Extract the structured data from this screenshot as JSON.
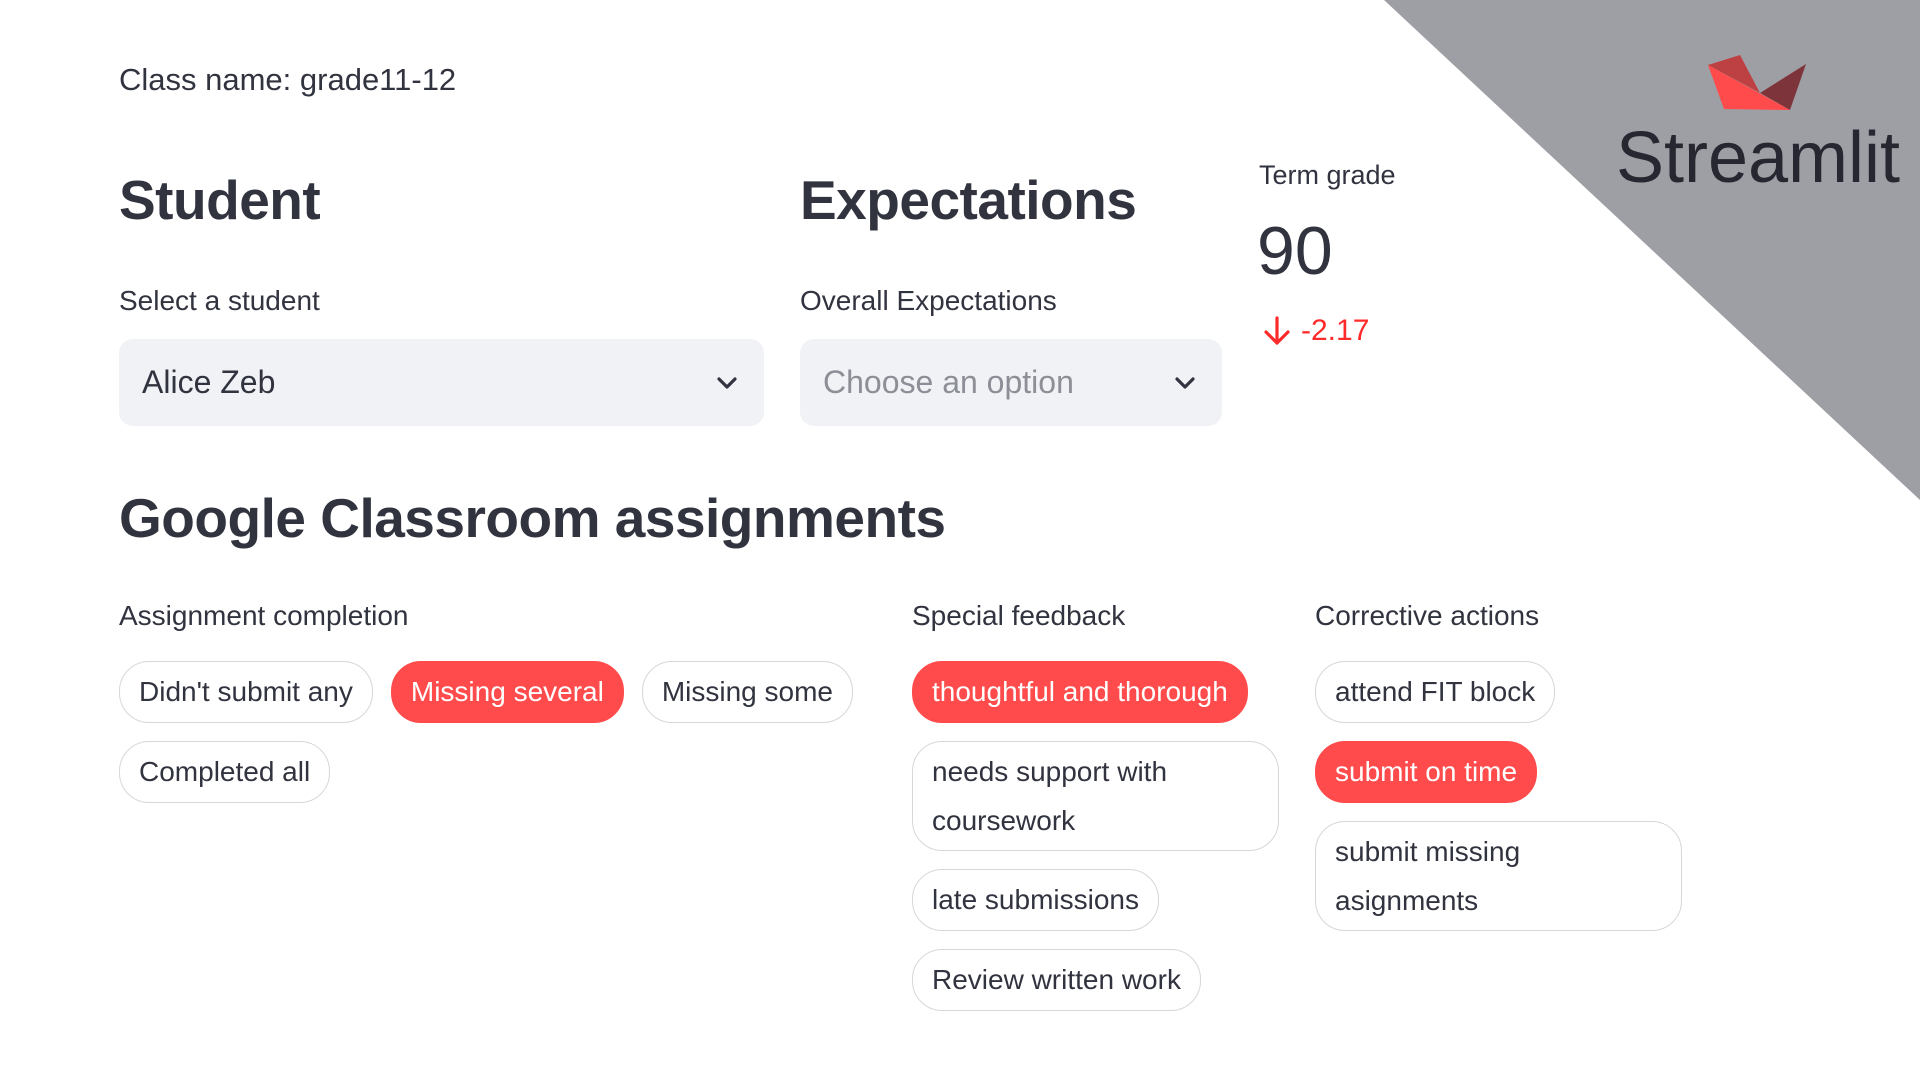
{
  "class_name": "Class name: grade11-12",
  "student_section": {
    "heading": "Student",
    "select_label": "Select a student",
    "select_value": "Alice Zeb"
  },
  "expectations_section": {
    "heading": "Expectations",
    "select_label": "Overall Expectations",
    "select_placeholder": "Choose an option"
  },
  "metric": {
    "label": "Term grade",
    "value": "90",
    "delta": "-2.17",
    "delta_direction": "down",
    "delta_color": "#ff2b2b"
  },
  "assignments": {
    "heading": "Google Classroom assignments",
    "groups": [
      {
        "label": "Assignment completion",
        "options": [
          {
            "label": "Didn't submit any",
            "selected": false
          },
          {
            "label": "Missing several",
            "selected": true
          },
          {
            "label": "Missing some",
            "selected": false
          },
          {
            "label": "Completed all",
            "selected": false
          }
        ]
      },
      {
        "label": "Special feedback",
        "options": [
          {
            "label": "thoughtful and thorough",
            "selected": true
          },
          {
            "label": "needs support with coursework",
            "selected": false
          },
          {
            "label": "late submissions",
            "selected": false
          },
          {
            "label": "Review written work",
            "selected": false
          }
        ]
      },
      {
        "label": "Corrective actions",
        "options": [
          {
            "label": "attend FIT block",
            "selected": false
          },
          {
            "label": "submit on time",
            "selected": true
          },
          {
            "label": "submit missing asignments",
            "selected": false
          }
        ]
      }
    ]
  },
  "branding": {
    "logo_text": "Streamlit",
    "accent_color": "#ff4b4b",
    "corner_color": "#9e9fa4"
  }
}
